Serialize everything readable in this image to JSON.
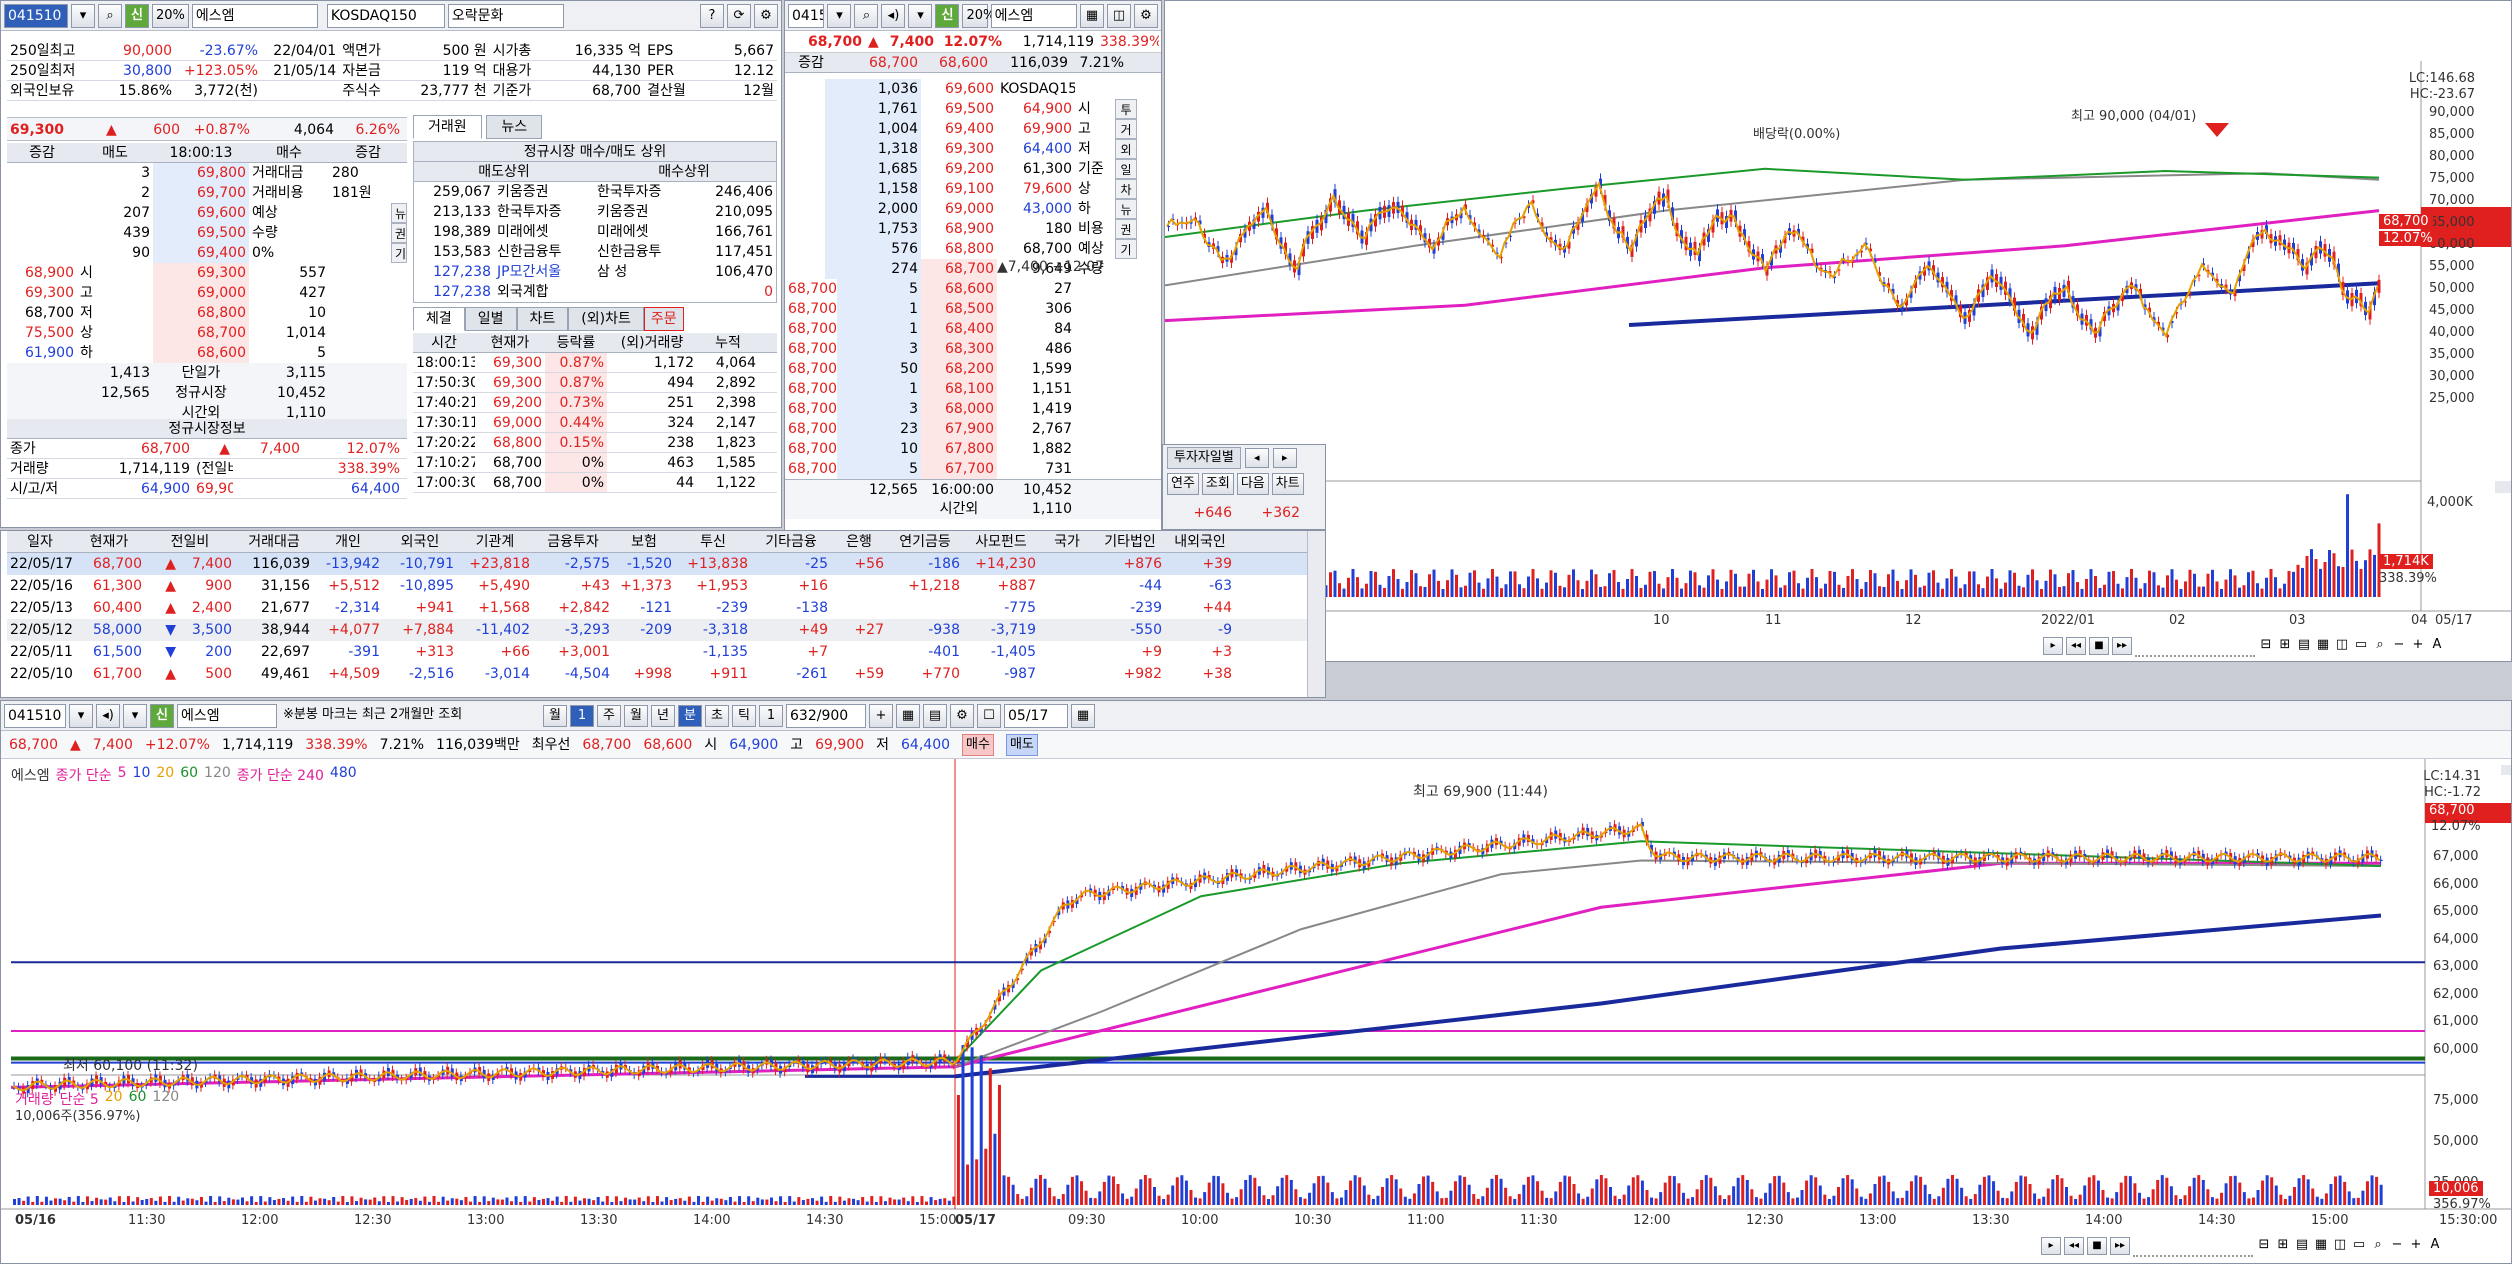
{
  "stock": {
    "code": "041510",
    "name": "에스엠",
    "pct_lbl": "20%",
    "sin": "신",
    "index": "KOSDAQ150",
    "sector": "오락문화"
  },
  "left": {
    "stats": [
      [
        "250일최고",
        "90,000",
        "-23.67%",
        "22/04/01",
        "액면가",
        "500 원",
        "시가총",
        "16,335 억",
        "EPS",
        "5,667"
      ],
      [
        "250일최저",
        "30,800",
        "+123.05%",
        "21/05/14",
        "자본금",
        "119 억",
        "대용가",
        "44,130",
        "PER",
        "12.12"
      ],
      [
        "외국인보유",
        "15.86%",
        "3,772(천)",
        "",
        "주식수",
        "23,777 천",
        "기준가",
        "68,700",
        "결산월",
        "12월"
      ]
    ],
    "afterhours": {
      "price": "69,300",
      "arrow": "▲",
      "chg": "600",
      "pct": "+0.87%",
      "vol": "4,064",
      "rate": "6.26%"
    },
    "ob_head": [
      "증감",
      "매도",
      "18:00:13",
      "매수",
      "증감"
    ],
    "ob_asks": [
      [
        "3",
        "69,800"
      ],
      [
        "2",
        "69,700"
      ],
      [
        "207",
        "69,600"
      ],
      [
        "439",
        "69,500"
      ],
      [
        "90",
        "69,400"
      ]
    ],
    "ob_bids": [
      [
        "69,300",
        "557"
      ],
      [
        "69,000",
        "427"
      ],
      [
        "68,800",
        "10"
      ],
      [
        "68,700",
        "1,014"
      ],
      [
        "68,600",
        "5"
      ]
    ],
    "ob_info": [
      [
        "거래대금",
        "280"
      ],
      [
        "거래비용",
        "181원"
      ],
      [
        "예상",
        ""
      ],
      [
        "수량",
        ""
      ],
      [
        "0%",
        ""
      ]
    ],
    "ob_left": [
      [
        "68,900",
        "시"
      ],
      [
        "69,300",
        "고"
      ],
      [
        "68,700",
        "저"
      ],
      [
        "75,500",
        "상"
      ],
      [
        "61,900",
        "하"
      ]
    ],
    "side_btns": [
      "뉴",
      "권",
      "기"
    ],
    "ob_tot": [
      [
        "1,413",
        "단일가",
        "3,115"
      ],
      [
        "12,565",
        "정규시장",
        "10,452"
      ],
      [
        "",
        "시간외",
        "1,110"
      ]
    ],
    "reg_title": "정규시장정보",
    "reg": [
      [
        "종가",
        "68,700",
        "▲",
        "7,400",
        "12.07%"
      ],
      [
        "거래량",
        "1,714,119",
        "(전일비)",
        "",
        "338.39%"
      ],
      [
        "시/고/저",
        "64,900",
        "69,900",
        "",
        "64,400"
      ]
    ],
    "tabs": [
      "거래원",
      "뉴스"
    ],
    "broker_title": "정규시장 매수/매도 상위",
    "broker_head": [
      "매도상위",
      "매수상위"
    ],
    "brokers": [
      [
        "259,067",
        "키움증권",
        "한국투자증",
        "246,406"
      ],
      [
        "213,133",
        "한국투자증",
        "키움증권",
        "210,095"
      ],
      [
        "198,389",
        "미래에셋",
        "미래에셋",
        "166,761"
      ],
      [
        "153,583",
        "신한금융투",
        "신한금융투",
        "117,451"
      ],
      [
        "127,238",
        "JP모간서울",
        "삼  성",
        "106,470"
      ],
      [
        "127,238",
        "외국계합",
        "",
        "0"
      ]
    ],
    "ttabs": [
      "체결",
      "일별",
      "차트",
      "(외)차트",
      "주문"
    ],
    "trade_head": [
      "시간",
      "현재가",
      "등락률",
      "(외)거래량",
      "누적"
    ],
    "trades": [
      [
        "18:00:13",
        "69,300",
        "0.87%",
        "1,172",
        "4,064"
      ],
      [
        "17:50:30",
        "69,300",
        "0.87%",
        "494",
        "2,892"
      ],
      [
        "17:40:21",
        "69,200",
        "0.73%",
        "251",
        "2,398"
      ],
      [
        "17:30:11",
        "69,000",
        "0.44%",
        "324",
        "2,147"
      ],
      [
        "17:20:22",
        "68,800",
        "0.15%",
        "238",
        "1,823"
      ],
      [
        "17:10:27",
        "68,700",
        "0%",
        "463",
        "1,585"
      ],
      [
        "17:00:30",
        "68,700",
        "0%",
        "44",
        "1,122"
      ]
    ]
  },
  "mid": {
    "head": {
      "price": "68,700",
      "arrow": "▲",
      "chg": "7,400",
      "pct": "12.07%",
      "vol": "1,714,119",
      "rate": "338.39%"
    },
    "head2": {
      "l": "증감",
      "p1": "68,700",
      "p2": "68,600",
      "vol": "116,039",
      "pct": "7.21%"
    },
    "asks": [
      [
        "1,036",
        "69,600"
      ],
      [
        "1,761",
        "69,500"
      ],
      [
        "1,004",
        "69,400"
      ],
      [
        "1,318",
        "69,300"
      ],
      [
        "1,685",
        "69,200"
      ],
      [
        "1,158",
        "69,100"
      ],
      [
        "2,000",
        "69,000"
      ],
      [
        "1,753",
        "68,900"
      ],
      [
        "576",
        "68,800"
      ],
      [
        "274",
        "68,700"
      ]
    ],
    "info": [
      [
        "KOSDAQ150",
        ""
      ],
      [
        "64,900",
        "시"
      ],
      [
        "69,900",
        "고"
      ],
      [
        "64,400",
        "저"
      ],
      [
        "61,300",
        "기준"
      ],
      [
        "79,600",
        "상"
      ],
      [
        "43,000",
        "하"
      ],
      [
        "180",
        "비용"
      ],
      [
        "68,700",
        "예상"
      ],
      [
        "9,649",
        "수량"
      ],
      [
        "▲7,400",
        "+12.07"
      ]
    ],
    "vtabs": [
      "투",
      "거",
      "외",
      "일",
      "차",
      "뉴",
      "권",
      "기"
    ],
    "bids": [
      [
        "68,700",
        "5",
        "68,600",
        "27"
      ],
      [
        "68,700",
        "1",
        "68,500",
        "306"
      ],
      [
        "68,700",
        "1",
        "68,400",
        "84"
      ],
      [
        "68,700",
        "3",
        "68,300",
        "486"
      ],
      [
        "68,700",
        "50",
        "68,200",
        "1,599"
      ],
      [
        "68,700",
        "1",
        "68,100",
        "1,151"
      ],
      [
        "68,700",
        "3",
        "68,000",
        "1,419"
      ],
      [
        "68,700",
        "23",
        "67,900",
        "2,767"
      ],
      [
        "68,700",
        "10",
        "67,800",
        "1,882"
      ],
      [
        "68,700",
        "5",
        "67,700",
        "731"
      ]
    ],
    "tot": [
      "12,565",
      "16:00:00",
      "10,452"
    ],
    "tot2": [
      "시간외",
      "1,110"
    ]
  },
  "inv": {
    "title": "투자자일별",
    "btns": [
      "연주",
      "조회",
      "다음",
      "차트"
    ],
    "sum": [
      "+646",
      "+362"
    ],
    "head": [
      "일자",
      "현재가",
      "전일비",
      "거래대금",
      "개인",
      "외국인",
      "기관계",
      "금융투자",
      "보험",
      "투신",
      "기타금융",
      "은행",
      "연기금등",
      "사모펀드",
      "국가",
      "기타법인",
      "내외국인"
    ],
    "rows": [
      [
        "22/05/17",
        "68,700",
        "▲",
        "7,400",
        "116,039",
        "-13,942",
        "-10,791",
        "+23,818",
        "-2,575",
        "-1,520",
        "+13,838",
        "-25",
        "+56",
        "-186",
        "+14,230",
        "",
        "+876",
        "+39"
      ],
      [
        "22/05/16",
        "61,300",
        "▲",
        "900",
        "31,156",
        "+5,512",
        "-10,895",
        "+5,490",
        "+43",
        "+1,373",
        "+1,953",
        "+16",
        "",
        "+1,218",
        "+887",
        "",
        "-44",
        "-63"
      ],
      [
        "22/05/13",
        "60,400",
        "▲",
        "2,400",
        "21,677",
        "-2,314",
        "+941",
        "+1,568",
        "+2,842",
        "-121",
        "-239",
        "-138",
        "",
        "",
        "-775",
        "",
        "-239",
        "+44"
      ],
      [
        "22/05/12",
        "58,000",
        "▼",
        "3,500",
        "38,944",
        "+4,077",
        "+7,884",
        "-11,402",
        "-3,293",
        "-209",
        "-3,318",
        "+49",
        "+27",
        "-938",
        "-3,719",
        "",
        "-550",
        "-9"
      ],
      [
        "22/05/11",
        "61,500",
        "▼",
        "200",
        "22,697",
        "-391",
        "+313",
        "+66",
        "+3,001",
        "",
        "-1,135",
        "+7",
        "",
        "-401",
        "-1,405",
        "",
        "+9",
        "+3"
      ],
      [
        "22/05/10",
        "61,700",
        "▲",
        "500",
        "49,461",
        "+4,509",
        "-2,516",
        "-3,014",
        "-4,504",
        "+998",
        "+911",
        "-261",
        "+59",
        "+770",
        "-987",
        "",
        "+982",
        "+38"
      ]
    ]
  },
  "daily": {
    "lc": "LC:146.68",
    "hc": "HC:-23.67",
    "peak_lbl": "최고 90,000 (04/01)",
    "div_lbl": "배당락(0.00%)",
    "price_tag": "68,700",
    "pct_tag": "12.07%",
    "yticks": [
      "90,000",
      "85,000",
      "80,000",
      "75,000",
      "70,000",
      "65,000",
      "60,000",
      "55,000",
      "50,000",
      "45,000",
      "40,000",
      "35,000",
      "30,000",
      "25,000"
    ],
    "vticks": [
      "4,000K"
    ],
    "vol_tag": "1,714K",
    "vol_pct": "338.39%",
    "xticks": [
      "10",
      "11",
      "12",
      "2022/01",
      "02",
      "03",
      "04",
      "05"
    ],
    "xend": "05/17"
  },
  "intra": {
    "code": "041510",
    "name": "에스엠",
    "note": "※분봉 마크는 최근 2개월만 조회",
    "period_btns": [
      "월",
      "1",
      "주",
      "월",
      "년",
      "분",
      "초",
      "틱",
      "1"
    ],
    "count": "632/900",
    "date": "05/17",
    "quote": {
      "price": "68,700",
      "arrow": "▲",
      "chg": "7,400",
      "pct": "+12.07%",
      "vol": "1,714,119",
      "rate": "338.39%",
      "pct2": "7.21%",
      "amt": "116,039백만",
      "best_l": "최우선",
      "b1": "68,700",
      "b2": "68,600",
      "s": "시",
      "sv": "64,900",
      "h": "고",
      "hv": "69,900",
      "l": "저",
      "lv": "64,400",
      "buy": "매수",
      "sell": "매도"
    },
    "legend": {
      "n": "에스엠",
      "ma": "종가 단순",
      "m5": "5",
      "m10": "10",
      "m20": "20",
      "m60": "60",
      "m120": "120",
      "ma2": "종가 단순 240",
      "m480": "480"
    },
    "peak_lbl": "최고 69,900 (11:44)",
    "low_lbl": "최저 60,100 (11:32)",
    "lc": "LC:14.31",
    "hc": "HC:-1.72",
    "price_tag": "68,700",
    "pct_tag": "12.07%",
    "yticks": [
      "67,000",
      "66,000",
      "65,000",
      "64,000",
      "63,000",
      "62,000",
      "61,000",
      "60,000"
    ],
    "vlegend": {
      "n": "거래량",
      "ma": "단순 5",
      "m20": "20",
      "m60": "60",
      "m120": "120"
    },
    "vinfo": "10,006주(356.97%)",
    "vticks": [
      "75,000",
      "50,000",
      "25,000"
    ],
    "vol_tag": "10,006",
    "vol_pct": "356.97%",
    "xticks": [
      "05/16",
      "11:30",
      "12:00",
      "12:30",
      "13:00",
      "13:30",
      "14:00",
      "14:30",
      "15:00",
      "05/17",
      "09:30",
      "10:00",
      "10:30",
      "11:00",
      "11:30",
      "12:00",
      "12:30",
      "13:00",
      "13:30",
      "14:00",
      "14:30",
      "15:00"
    ],
    "xend": "15:30:00"
  }
}
